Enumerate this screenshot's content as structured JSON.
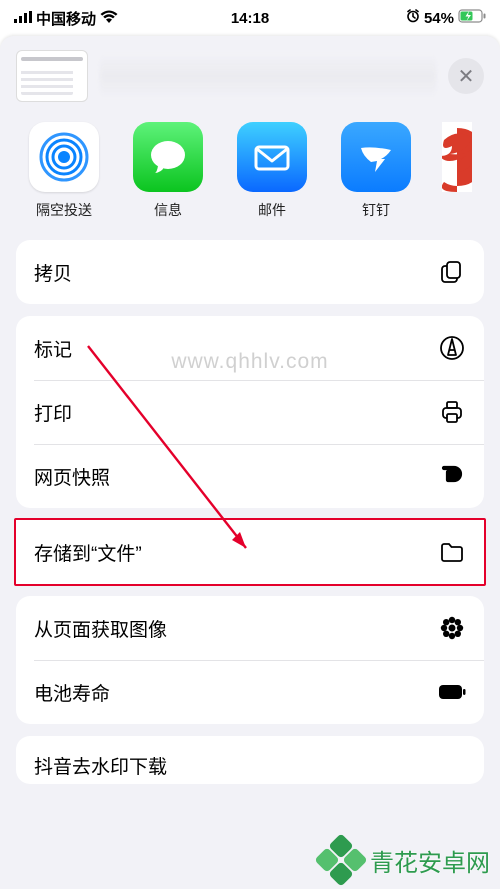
{
  "status": {
    "carrier": "中国移动",
    "time": "14:18",
    "battery_pct": "54%"
  },
  "close_glyph": "✕",
  "apps": {
    "airdrop": "隔空投送",
    "messages": "信息",
    "mail": "邮件",
    "dingtalk": "钉钉"
  },
  "actions": {
    "copy": "拷贝",
    "markup": "标记",
    "print": "打印",
    "snapshot": "网页快照",
    "save_files": "存储到“文件”",
    "get_images": "从页面获取图像",
    "battery_life": "电池寿命",
    "douyin_dl": "抖音去水印下载"
  },
  "watermark": {
    "url": "www.qhhlv.com",
    "brand": "青花安卓网"
  }
}
